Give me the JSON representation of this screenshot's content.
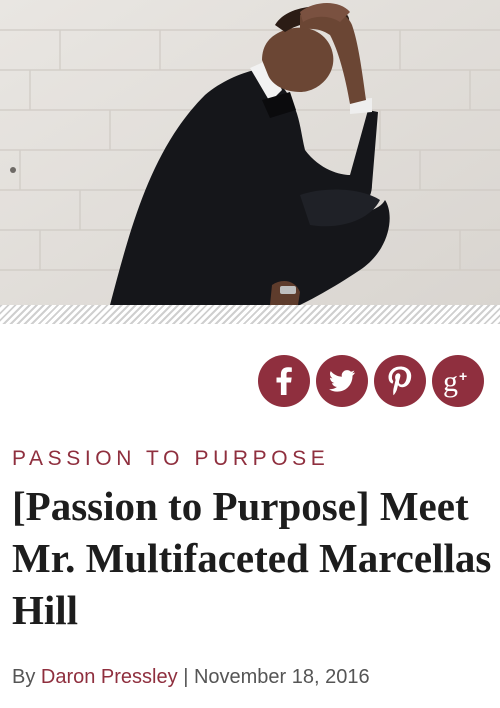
{
  "article": {
    "category": "PASSION TO PURPOSE",
    "title": "[Passion to Purpose] Meet Mr. Multifaceted Marcellas Hill",
    "byline": {
      "prefix": "By",
      "author": "Daron Pressley",
      "separator": "|",
      "date": "November 18, 2016"
    }
  },
  "social": [
    {
      "icon": "facebook-icon",
      "glyph": "f"
    },
    {
      "icon": "twitter-icon",
      "glyph": "bird"
    },
    {
      "icon": "pinterest-icon",
      "glyph": "P"
    },
    {
      "icon": "google-plus-icon",
      "glyph": "g+"
    }
  ],
  "colors": {
    "accent": "#8f2f3e",
    "title_text": "#1d1d1d",
    "byline_text": "#555555"
  }
}
